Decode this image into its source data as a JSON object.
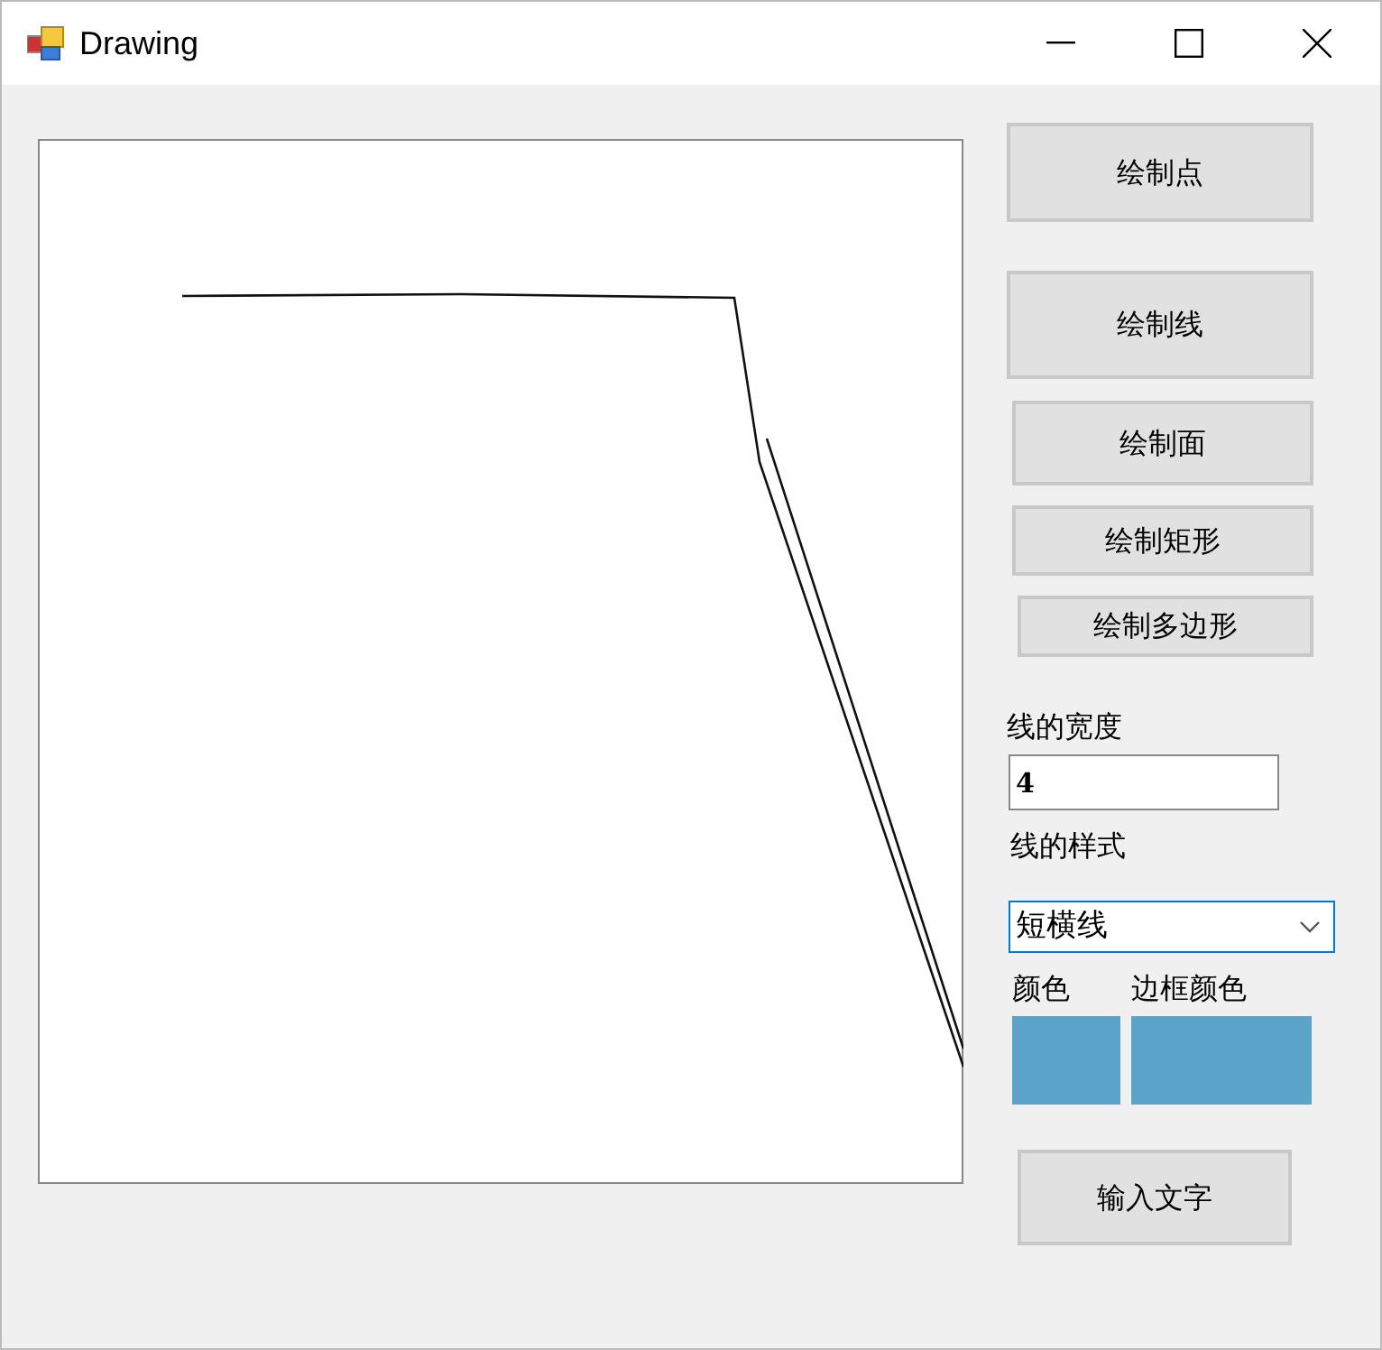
{
  "window": {
    "title": "Drawing"
  },
  "buttons": [
    {
      "label": "绘制点"
    },
    {
      "label": "绘制线"
    },
    {
      "label": "绘制面"
    },
    {
      "label": "绘制矩形"
    },
    {
      "label": "绘制多边形"
    }
  ],
  "line_width": {
    "label": "线的宽度",
    "value": "4"
  },
  "line_style": {
    "label": "线的样式",
    "value": "短横线"
  },
  "colors": [
    {
      "label": "颜色",
      "color": "#5ba3c9"
    },
    {
      "label": "边框颜色",
      "color": "#5ba3c9"
    }
  ],
  "text_button": {
    "label": "输入文字"
  }
}
